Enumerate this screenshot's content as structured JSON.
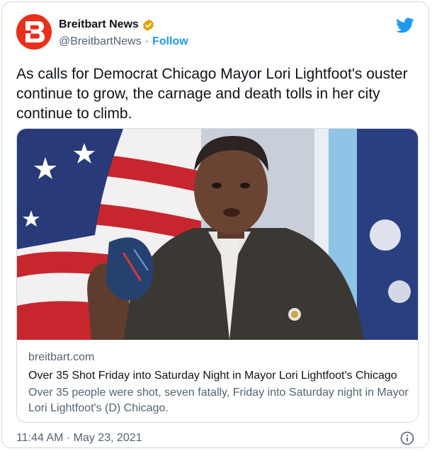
{
  "author": {
    "name": "Breitbart News",
    "handle": "@BreitbartNews",
    "separator": "·",
    "follow_label": "Follow",
    "avatar_letter": "B",
    "verified_icon": "verified-badge-icon",
    "verified_color": "#e1a100"
  },
  "platform_icon": "twitter-bird-icon",
  "brand_color": "#1d9bf0",
  "tweet": {
    "text": "As calls for Democrat Chicago Mayor Lori Lightfoot's ouster continue to grow, the carnage and death tolls in her city continue to climb."
  },
  "link_card": {
    "domain": "breitbart.com",
    "title": "Over 35 Shot Friday into Saturday Night in Mayor Lori Lightfoot's Chicago",
    "description": "Over 35 people were shot, seven fatally, Friday into Saturday night in Mayor Lori Lightfoot's (D) Chicago."
  },
  "footer": {
    "timestamp": "11:44 AM · May 23, 2021",
    "info_icon": "info-icon"
  }
}
